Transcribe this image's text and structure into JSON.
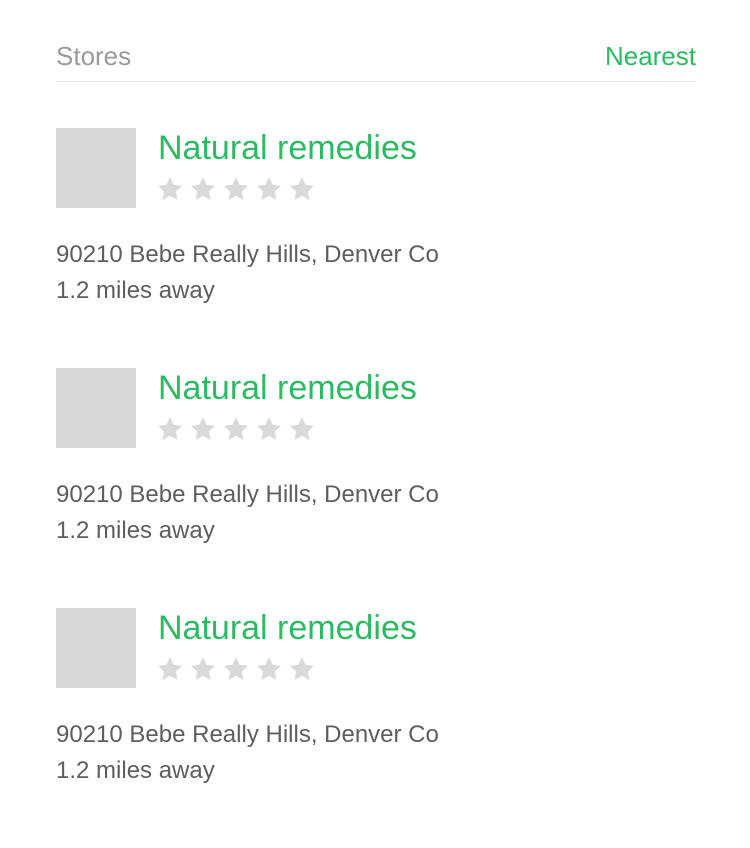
{
  "header": {
    "title": "Stores",
    "sort_label": "Nearest"
  },
  "colors": {
    "accent": "#2cbb63",
    "header_text": "#9a9a9a",
    "body_text": "#5e5e5e",
    "thumbnail": "#d9d9d9",
    "star_empty": "#d9d9d9"
  },
  "stores": [
    {
      "name": "Natural remedies",
      "rating": 0,
      "rating_max": 5,
      "address": "90210 Bebe Really Hills, Denver Co",
      "distance": "1.2 miles away"
    },
    {
      "name": "Natural remedies",
      "rating": 0,
      "rating_max": 5,
      "address": "90210 Bebe Really Hills, Denver Co",
      "distance": "1.2 miles away"
    },
    {
      "name": "Natural remedies",
      "rating": 0,
      "rating_max": 5,
      "address": "90210 Bebe Really Hills, Denver Co",
      "distance": "1.2 miles away"
    }
  ]
}
